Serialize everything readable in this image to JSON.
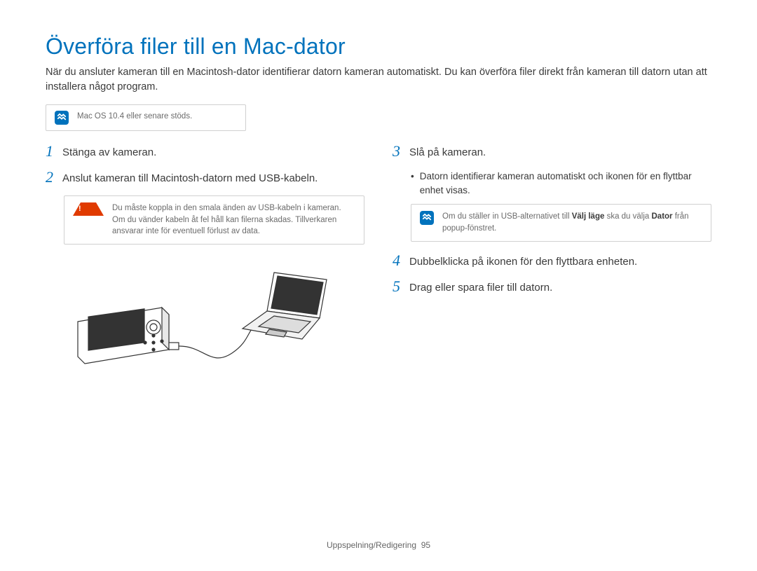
{
  "title": "Överföra filer till en Mac-dator",
  "intro": "När du ansluter kameran till en Macintosh-dator identifierar datorn kameran automatiskt. Du kan överföra filer direkt från kameran till datorn utan att installera något program.",
  "top_note": "Mac OS 10.4 eller senare stöds.",
  "left": {
    "step1": "Stänga av kameran.",
    "step2": "Anslut kameran till Macintosh-datorn med USB-kabeln.",
    "warn": "Du måste koppla in den smala änden av USB-kabeln i kameran. Om du vänder kabeln åt fel håll kan filerna skadas. Tillverkaren ansvarar inte för eventuell förlust av data."
  },
  "right": {
    "step3": "Slå på kameran.",
    "bullet3": "Datorn identifierar kameran automatiskt och ikonen för en flyttbar enhet visas.",
    "note3_pre": "Om du ställer in USB-alternativet till ",
    "note3_b1": "Välj läge",
    "note3_mid": " ska du välja ",
    "note3_b2": "Dator",
    "note3_post": " från popup-fönstret.",
    "step4": "Dubbelklicka på ikonen för den flyttbara enheten.",
    "step5": "Drag eller spara filer till datorn."
  },
  "footer_section": "Uppspelning/Redigering",
  "footer_page": "95"
}
